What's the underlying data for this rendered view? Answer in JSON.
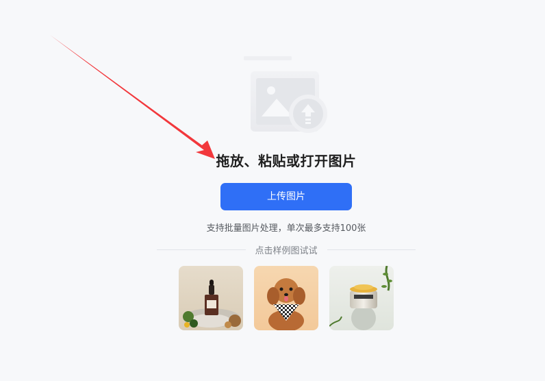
{
  "main": {
    "headline": "拖放、粘贴或打开图片",
    "upload_button": "上传图片",
    "hint": "支持批量图片处理，单次最多支持100张",
    "samples_label": "点击样例图试试"
  },
  "samples": [
    {
      "icon": "serum-bottle-sample-image"
    },
    {
      "icon": "puppy-sample-image"
    },
    {
      "icon": "cream-jar-sample-image"
    }
  ],
  "colors": {
    "accent": "#2f6ff6",
    "annotation_arrow": "#f2383c",
    "background": "#f7f8fa"
  }
}
